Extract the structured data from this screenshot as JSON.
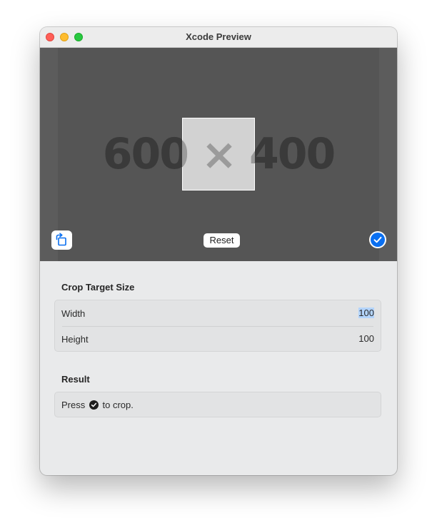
{
  "window": {
    "title": "Xcode Preview"
  },
  "preview": {
    "placeholder_text": "600 × 400",
    "reset_label": "Reset",
    "rotate_icon": "rotate-crop-icon",
    "confirm_icon": "checkmark-circle-icon"
  },
  "crop_target": {
    "heading": "Crop Target Size",
    "width_label": "Width",
    "width_value": "100",
    "height_label": "Height",
    "height_value": "100"
  },
  "result": {
    "heading": "Result",
    "text_before": "Press",
    "text_after": "to crop."
  },
  "colors": {
    "accent": "#0a6ff0",
    "selection": "#b3d4fc"
  }
}
